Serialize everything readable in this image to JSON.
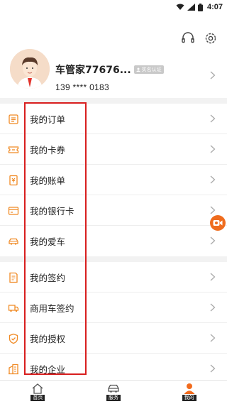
{
  "status_bar": {
    "time": "4:07"
  },
  "header": {
    "user_name": "车管家77676...",
    "verify_badge": "实名认证",
    "phone": "139 **** 0183"
  },
  "menu_group_1": [
    {
      "label": "我的订单",
      "icon": "order-list-icon"
    },
    {
      "label": "我的卡券",
      "icon": "coupon-icon"
    },
    {
      "label": "我的账单",
      "icon": "bill-icon"
    },
    {
      "label": "我的银行卡",
      "icon": "bank-card-icon"
    },
    {
      "label": "我的爱车",
      "icon": "car-icon"
    }
  ],
  "menu_group_2": [
    {
      "label": "我的签约",
      "icon": "contract-icon"
    },
    {
      "label": "商用车签约",
      "icon": "truck-icon"
    },
    {
      "label": "我的授权",
      "icon": "shield-icon"
    },
    {
      "label": "我的企业",
      "icon": "building-icon"
    }
  ],
  "tabbar": [
    {
      "label": "首页",
      "icon": "home-icon",
      "active": false
    },
    {
      "label": "服务",
      "icon": "service-car-icon",
      "active": false
    },
    {
      "label": "我的",
      "icon": "user-icon",
      "active": true
    }
  ],
  "colors": {
    "accent": "#f08a24",
    "active_tab": "#f26b1d",
    "highlight": "#d81e1e"
  }
}
